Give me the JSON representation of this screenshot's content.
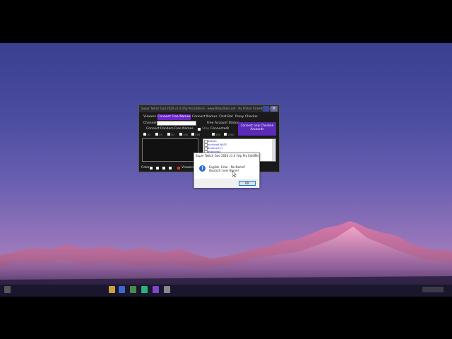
{
  "app": {
    "title": "Super Twitch God 2020 v1.4 (Vip Pro Edition) - www.BlabaTools.net - By Proton Streetbeasts",
    "close_glyph": "×",
    "tabs": [
      "Viewers",
      "Connect Free Names",
      "Connect Names",
      "Chat Bot",
      "Proxy Checker"
    ],
    "active_tab": 1,
    "channel_label": "Channel",
    "free_account_status_label": "Free Account Status",
    "connect_random_label": "Connect Random Free Names",
    "stop_label": "Stop",
    "connected_label": "Connected",
    "connected_count": "0",
    "connect_checked_button": "Connect only Checked Accounts",
    "count_options": [
      "10",
      "25",
      "50",
      "100",
      "250",
      "500",
      "1000"
    ],
    "accounts": [
      "Bakoks",
      "burklow8 N8ZF",
      "Burklow711",
      "gyzonvia3"
    ],
    "color_label": "Color",
    "viewers_label": "Viewers"
  },
  "dialog": {
    "title": "Super Twitch God 2020 v1.4 (Vip Pro Edition)",
    "close_glyph": "×",
    "icon": "info-icon",
    "icon_glyph": "i",
    "line1": "English: Error - No Name?",
    "line2": "Deutsch: kein Name?",
    "ok_label": "OK"
  },
  "colors": {
    "accent": "#6e24c8",
    "app_bg": "#1a1a1a",
    "dialog_icon": "#2d6fd8",
    "sky_top": "#3a3f90",
    "sky_bottom": "#b888c4"
  }
}
